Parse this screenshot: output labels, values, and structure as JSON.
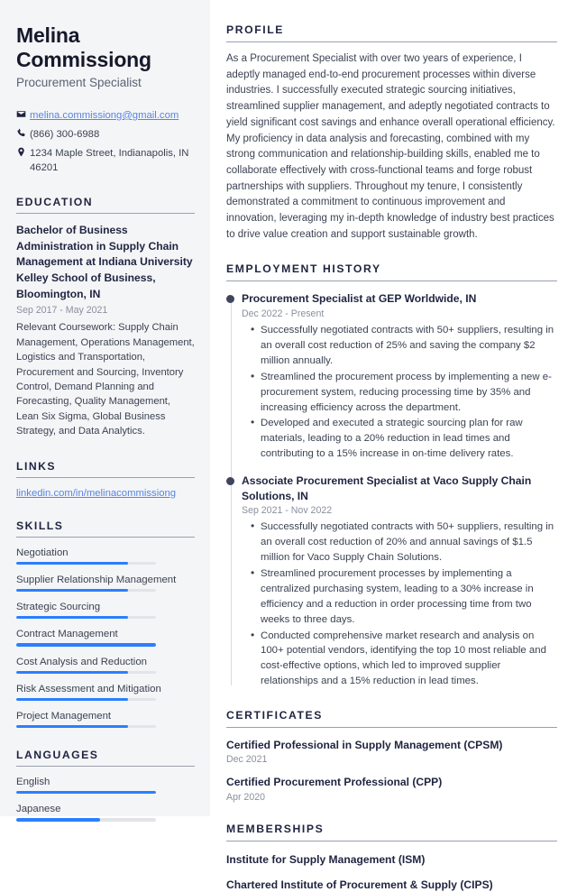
{
  "colors": {
    "sidebar_bg": "#f4f5f7",
    "heading": "#1f2440",
    "body_text": "#3b4252",
    "muted": "#8a909d",
    "accent_bar": "#2b7fff",
    "link": "#5585e0",
    "rule": "#9aa0ad",
    "timeline_dot": "#40455c"
  },
  "header": {
    "name": "Melina Commissiong",
    "job_title": "Procurement Specialist",
    "contacts": [
      {
        "icon": "envelope-icon",
        "text": "melina.commissiong@gmail.com",
        "is_link": true
      },
      {
        "icon": "phone-icon",
        "text": "(866) 300-6988",
        "is_link": false
      },
      {
        "icon": "location-pin-icon",
        "text": "1234 Maple Street, Indianapolis, IN 46201",
        "is_link": false
      }
    ]
  },
  "sidebar": {
    "education": {
      "heading": "EDUCATION",
      "degree": "Bachelor of Business Administration in Supply Chain Management at Indiana University Kelley School of Business, Bloomington, IN",
      "date": "Sep 2017 - May 2021",
      "description": "Relevant Coursework: Supply Chain Management, Operations Management, Logistics and Transportation, Procurement and Sourcing, Inventory Control, Demand Planning and Forecasting, Quality Management, Lean Six Sigma, Global Business Strategy, and Data Analytics."
    },
    "links": {
      "heading": "LINKS",
      "items": [
        {
          "label": "linkedin.com/in/melinacommissiong"
        }
      ]
    },
    "skills": {
      "heading": "SKILLS",
      "items": [
        {
          "label": "Negotiation",
          "level": 80
        },
        {
          "label": "Supplier Relationship Management",
          "level": 80
        },
        {
          "label": "Strategic Sourcing",
          "level": 80
        },
        {
          "label": "Contract Management",
          "level": 100
        },
        {
          "label": "Cost Analysis and Reduction",
          "level": 80
        },
        {
          "label": "Risk Assessment and Mitigation",
          "level": 80
        },
        {
          "label": "Project Management",
          "level": 80
        }
      ]
    },
    "languages": {
      "heading": "LANGUAGES",
      "items": [
        {
          "label": "English",
          "level": 100
        },
        {
          "label": "Japanese",
          "level": 60
        }
      ]
    }
  },
  "main": {
    "profile": {
      "heading": "PROFILE",
      "text": "As a Procurement Specialist with over two years of experience, I adeptly managed end-to-end procurement processes within diverse industries. I successfully executed strategic sourcing initiatives, streamlined supplier management, and adeptly negotiated contracts to yield significant cost savings and enhance overall operational efficiency. My proficiency in data analysis and forecasting, combined with my strong communication and relationship-building skills, enabled me to collaborate effectively with cross-functional teams and forge robust partnerships with suppliers. Throughout my tenure, I consistently demonstrated a commitment to continuous improvement and innovation, leveraging my in-depth knowledge of industry best practices to drive value creation and support sustainable growth."
    },
    "employment": {
      "heading": "EMPLOYMENT HISTORY",
      "jobs": [
        {
          "title": "Procurement Specialist at GEP Worldwide, IN",
          "date": "Dec 2022 - Present",
          "bullets": [
            "Successfully negotiated contracts with 50+ suppliers, resulting in an overall cost reduction of 25% and saving the company $2 million annually.",
            "Streamlined the procurement process by implementing a new e-procurement system, reducing processing time by 35% and increasing efficiency across the department.",
            "Developed and executed a strategic sourcing plan for raw materials, leading to a 20% reduction in lead times and contributing to a 15% increase in on-time delivery rates."
          ]
        },
        {
          "title": "Associate Procurement Specialist at Vaco Supply Chain Solutions, IN",
          "date": "Sep 2021 - Nov 2022",
          "bullets": [
            "Successfully negotiated contracts with 50+ suppliers, resulting in an overall cost reduction of 20% and annual savings of $1.5 million for Vaco Supply Chain Solutions.",
            "Streamlined procurement processes by implementing a centralized purchasing system, leading to a 30% increase in efficiency and a reduction in order processing time from two weeks to three days.",
            "Conducted comprehensive market research and analysis on 100+ potential vendors, identifying the top 10 most reliable and cost-effective options, which led to improved supplier relationships and a 15% reduction in lead times."
          ]
        }
      ]
    },
    "certificates": {
      "heading": "CERTIFICATES",
      "items": [
        {
          "name": "Certified Professional in Supply Management (CPSM)",
          "date": "Dec 2021"
        },
        {
          "name": "Certified Procurement Professional (CPP)",
          "date": "Apr 2020"
        }
      ]
    },
    "memberships": {
      "heading": "MEMBERSHIPS",
      "items": [
        {
          "name": "Institute for Supply Management (ISM)"
        },
        {
          "name": "Chartered Institute of Procurement & Supply (CIPS)"
        }
      ]
    }
  }
}
